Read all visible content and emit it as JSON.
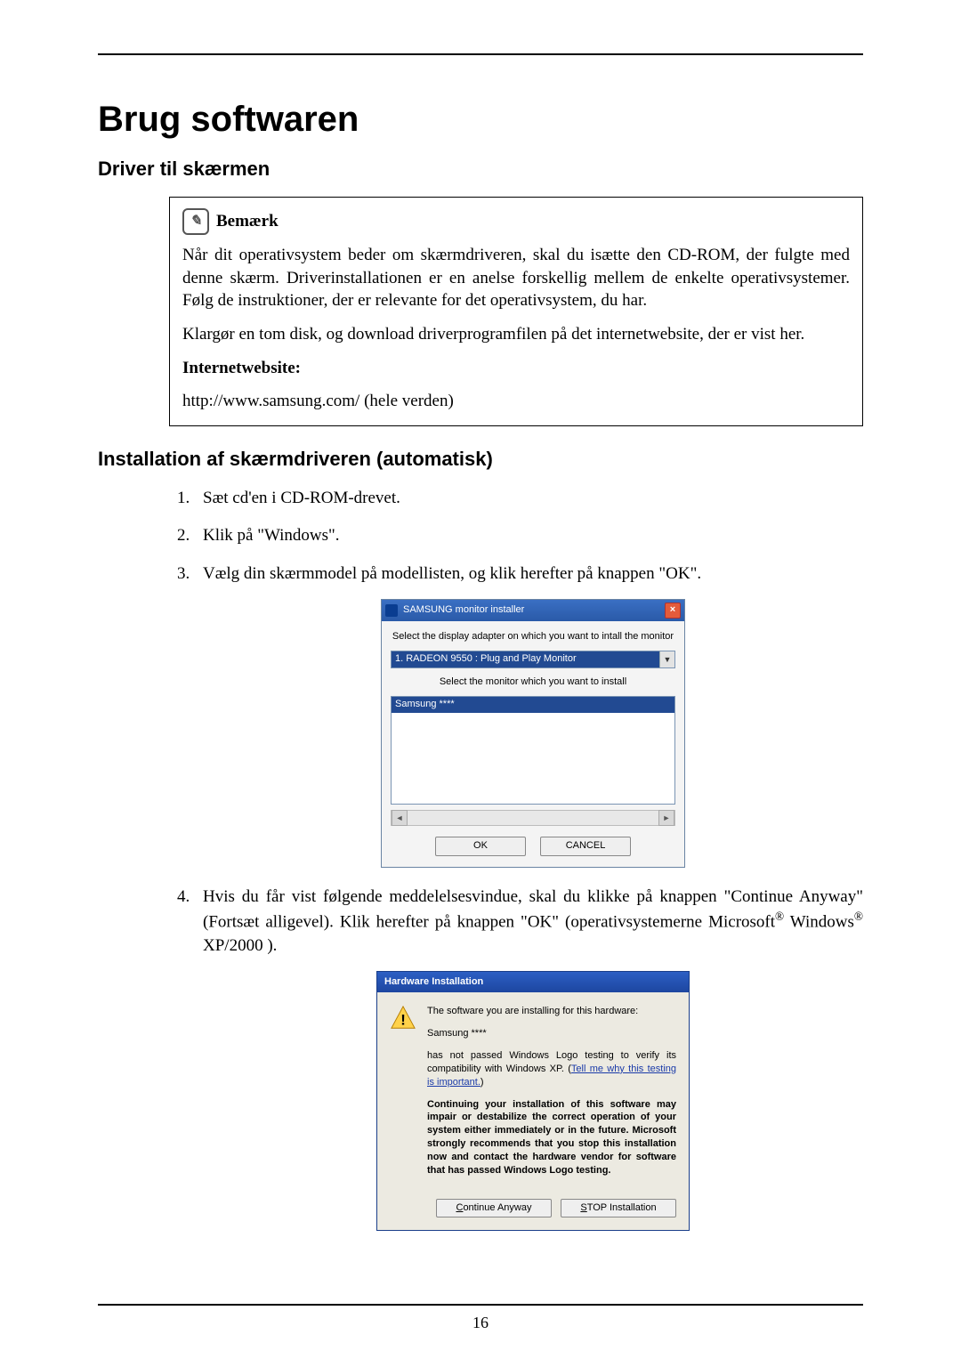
{
  "page_number": "16",
  "h1": "Brug softwaren",
  "h2_driver": "Driver til skærmen",
  "note": {
    "title": "Bemærk",
    "p1": "Når dit operativsystem beder om skærmdriveren, skal du isætte den CD-ROM, der fulgte med denne skærm. Driverinstallationen er en anelse forskellig mellem de enkelte operativsystemer. Følg de instruktioner, der er relevante for det operativsystem, du har.",
    "p2": "Klargør en tom disk, og download driverprogramfilen på det internetwebsite, der er vist her.",
    "website_label": "Internetwebsite:",
    "url": "http://www.samsung.com/ (hele verden)"
  },
  "h2_install": "Installation af skærmdriveren (automatisk)",
  "steps": {
    "s1": "Sæt cd'en i CD-ROM-drevet.",
    "s2": "Klik på \"Windows\".",
    "s3": "Vælg din skærmmodel på modellisten, og klik herefter på knappen \"OK\".",
    "s4_a": "Hvis du får vist følgende meddelelsesvindue, skal du klikke på knappen \"Continue Anyway\" (Fortsæt alligevel). Klik herefter på knappen \"OK\" (operativsystemerne Microsoft",
    "s4_b": " Windows",
    "s4_c": " XP/2000 ).",
    "reg": "®"
  },
  "installer": {
    "title": "SAMSUNG monitor installer",
    "label1": "Select the display adapter on which you want to intall the monitor",
    "dropdown": "1. RADEON 9550 : Plug and Play Monitor",
    "label2": "Select the monitor which you want to install",
    "list_item": "Samsung ****",
    "ok": "OK",
    "cancel": "CANCEL"
  },
  "hw": {
    "title": "Hardware Installation",
    "p1": "The software you are installing for this hardware:",
    "p2": "Samsung ****",
    "p3a": "has not passed Windows Logo testing to verify its compatibility with Windows XP. (",
    "p3link": "Tell me why this testing is important.",
    "p3b": ")",
    "p4": "Continuing your installation of this software may impair or destabilize the correct operation of your system either immediately or in the future. Microsoft strongly recommends that you stop this installation now and contact the hardware vendor for software that has passed Windows Logo testing.",
    "btn_continue": "Continue Anyway",
    "btn_stop": "STOP Installation"
  }
}
